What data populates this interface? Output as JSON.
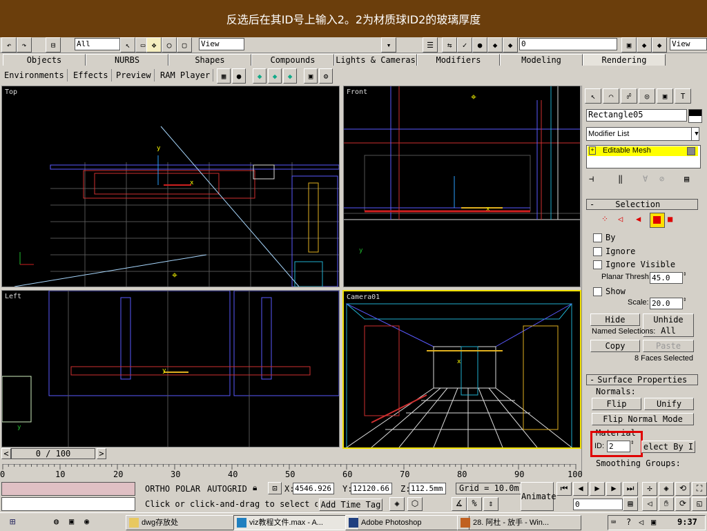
{
  "banner": {
    "text": "反选后在其ID号上输入2。2为材质球ID2的玻璃厚度"
  },
  "toolbar": {
    "selection_filter": "All",
    "view_left": "View",
    "view_right": "View",
    "small_value": "0"
  },
  "tabs": [
    {
      "label": "Objects"
    },
    {
      "label": "NURBS"
    },
    {
      "label": "Shapes"
    },
    {
      "label": "Compounds"
    },
    {
      "label": "Lights & Cameras"
    },
    {
      "label": "Modifiers"
    },
    {
      "label": "Modeling"
    },
    {
      "label": "Rendering",
      "active": true
    }
  ],
  "subbar": {
    "items": [
      "Environments",
      "Effects",
      "Preview",
      "RAM Player"
    ]
  },
  "viewports": {
    "top": "Top",
    "front": "Front",
    "left": "Left",
    "camera": "Camera01"
  },
  "command_panel": {
    "object_name": "Rectangle05",
    "modifier_list": "Modifier List",
    "stack_item": "Editable Mesh",
    "selection_rollout": "Selection",
    "by_label": "By",
    "ignore_label": "Ignore",
    "ignore_visible_label": "Ignore Visible",
    "planar_thresh_label": "Planar Thresh:",
    "planar_thresh_value": "45.0",
    "show_label": "Show",
    "scale_label": "Scale:",
    "scale_value": "20.0",
    "hide_btn": "Hide",
    "unhide_all_btn": "Unhide All",
    "named_selections": "Named Selections:",
    "copy_btn": "Copy",
    "paste_btn": "Paste",
    "faces_selected": "8 Faces Selected",
    "surface_props": "Surface Properties",
    "normals_label": "Normals:",
    "flip_btn": "Flip",
    "unify_btn": "Unify",
    "flip_normal_mode_btn": "Flip Normal Mode",
    "material_label": "Material",
    "id_label": "ID:",
    "id_value": "2",
    "select_by_id_btn": "elect By I",
    "smoothing_groups": "Smoothing Groups:"
  },
  "timeline": {
    "frame": "0 / 100"
  },
  "ruler": {
    "ticks": [
      "0",
      "10",
      "20",
      "30",
      "40",
      "50",
      "60",
      "70",
      "80",
      "90",
      "100"
    ]
  },
  "status": {
    "ortho": "ORTHO",
    "polar": "POLAR",
    "autogrid": "AUTOGRID",
    "x_label": "X:",
    "x_value": "4546.926",
    "y_label": "Y:",
    "y_value": "12120.66",
    "z_label": "Z:",
    "z_value": "112.5mm",
    "grid": "Grid = 10.0m",
    "prompt": "Click or click-and-drag to select o",
    "add_time_tag": "Add Time Tag",
    "animate": "Animate",
    "frame_field": "0"
  },
  "taskbar": {
    "items": [
      {
        "label": "dwg存放处"
      },
      {
        "label": "viz教程文件.max - A...",
        "active": true
      },
      {
        "label": "Adobe Photoshop"
      },
      {
        "label": "28. 阿杜 - 放手 - Win..."
      }
    ],
    "clock": "9:37"
  },
  "colors": {
    "banner_bg": "#6b3e0c",
    "active_viewport": "#f0e000",
    "highlight_box": "#e00000",
    "stack_highlight": "#ffff00"
  }
}
